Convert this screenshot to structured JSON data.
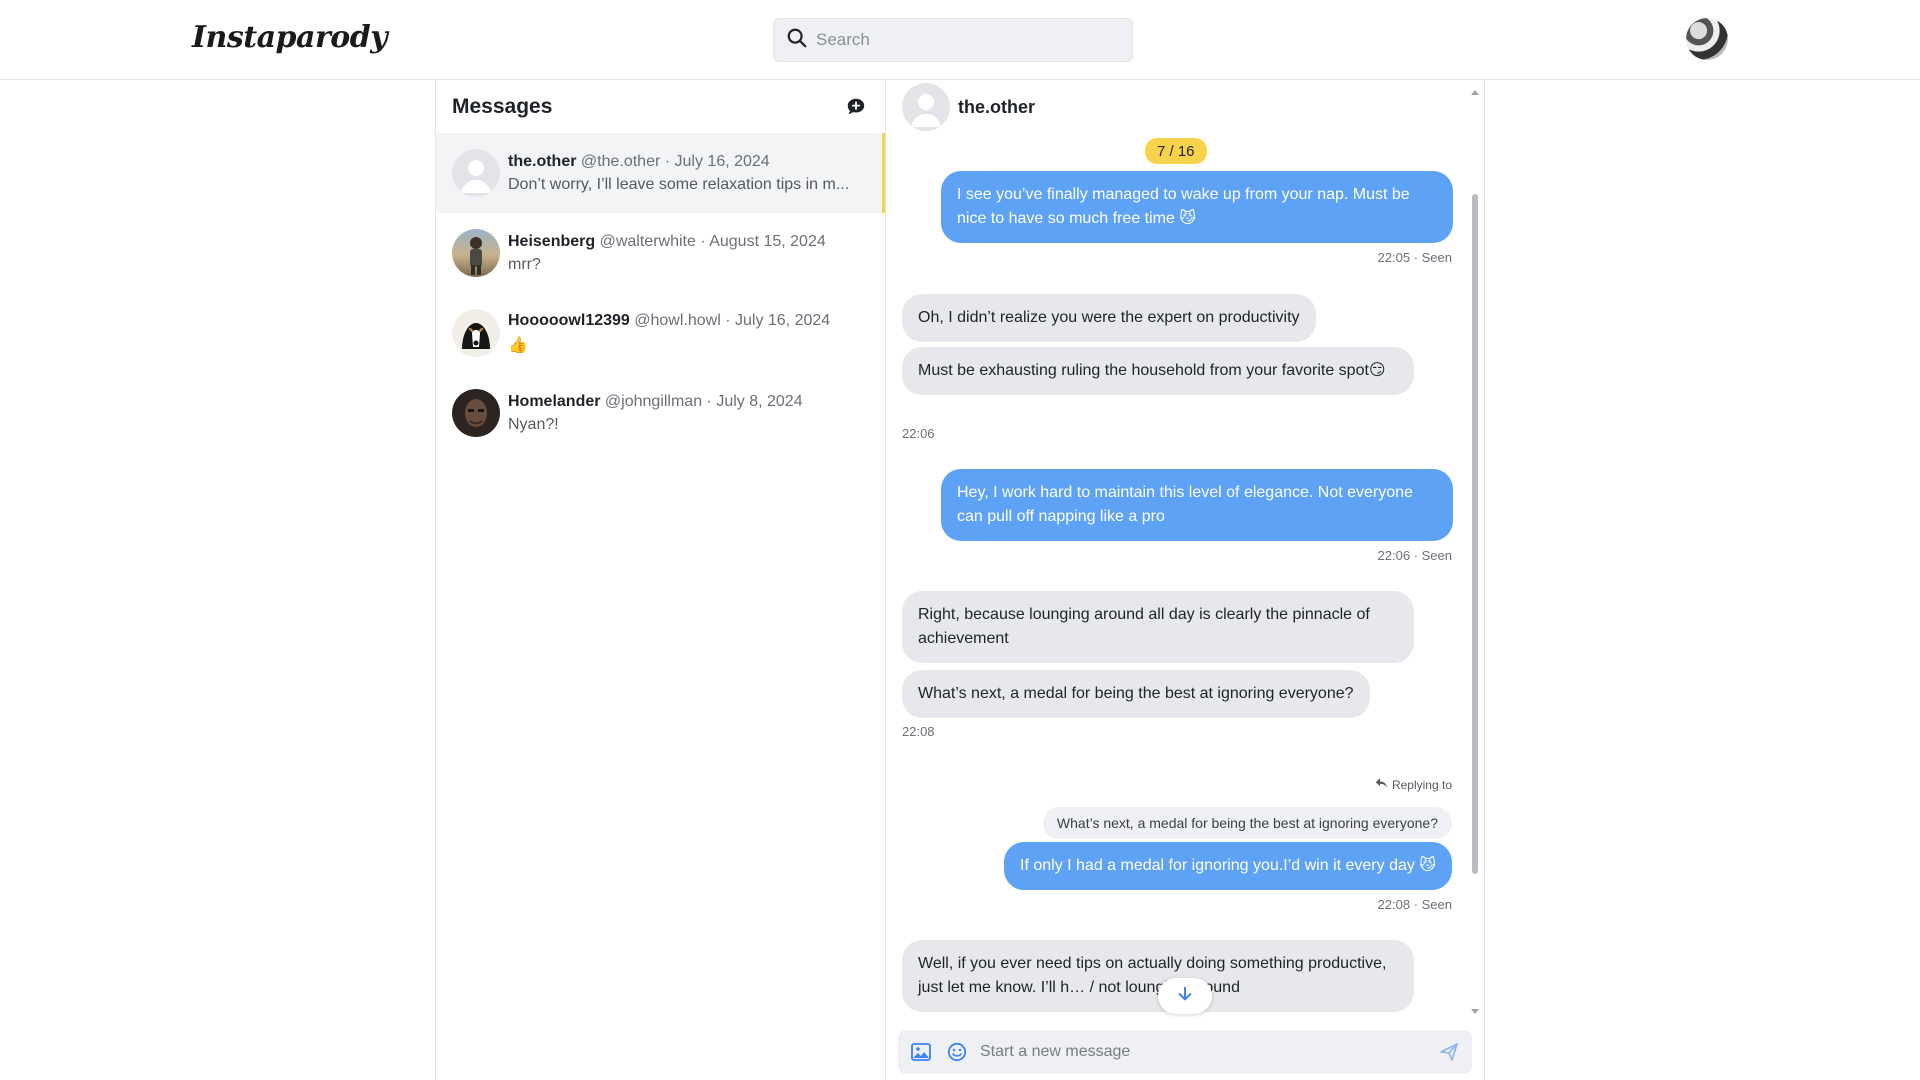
{
  "app": {
    "logo": "Instaparody"
  },
  "search": {
    "placeholder": "Search"
  },
  "messages_panel": {
    "title": "Messages",
    "conversations": [
      {
        "name": "the.other",
        "meta": "@the.other · July 16, 2024",
        "last": "Don’t worry, I’ll leave some relaxation tips in m...",
        "active": true
      },
      {
        "name": "Heisenberg",
        "meta": "@walterwhite · August 15, 2024",
        "last": "mrr?"
      },
      {
        "name": "Hooooowl12399",
        "meta": "@howl.howl · July 16, 2024",
        "last": "👍"
      },
      {
        "name": "Homelander",
        "meta": "@johngillman · July 8, 2024",
        "last": "Nyan?!"
      }
    ]
  },
  "chat": {
    "title": "the.other",
    "counter": "7 / 16",
    "messages": [
      {
        "text": "I see you’ve finally managed to wake up from your nap. Must be nice to have so much free time 😼",
        "stamp": "22:05 · Seen"
      },
      {
        "text": "Oh, I didn’t realize you were the expert on productivity"
      },
      {
        "text": "Must be exhausting ruling the household from your favorite spot😏",
        "stamp": "22:06"
      },
      {
        "text": "Hey, I work hard to maintain this level of elegance. Not everyone can pull off napping like a pro",
        "stamp": "22:06 · Seen"
      },
      {
        "text": "Right, because lounging around all day is clearly the pinnacle of achievement"
      },
      {
        "text": "What’s next, a medal for being the best at ignoring everyone?",
        "stamp": "22:08"
      },
      {
        "reply_label": "Replying to",
        "quoted": "What’s next, a medal for being the best at ignoring everyone?",
        "text": "If only I had a medal for ignoring you.I’d win it every day 😼",
        "stamp": "22:08 · Seen"
      },
      {
        "text": "Well, if you ever need tips on actually doing something productive, just let me know. I’ll h… / not lounging around"
      }
    ],
    "composer_placeholder": "Start a new message"
  }
}
